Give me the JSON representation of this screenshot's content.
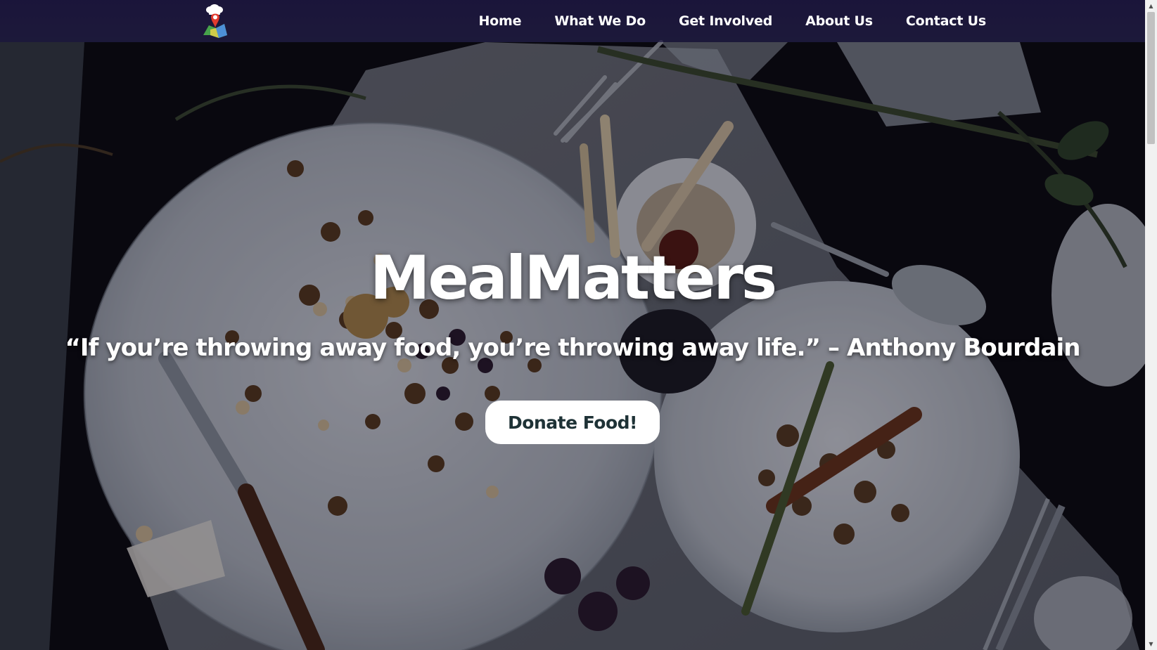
{
  "navbar": {
    "logo_name": "chef-map-pin-logo",
    "links": [
      {
        "label": "Home"
      },
      {
        "label": "What We Do"
      },
      {
        "label": "Get Involved"
      },
      {
        "label": "About Us"
      },
      {
        "label": "Contact Us"
      }
    ]
  },
  "hero": {
    "title": "MealMatters",
    "quote": "“If you’re throwing away food, you’re throwing away life.” – Anthony Bourdain",
    "cta_label": "Donate Food!",
    "background_description_icon": "leftover-food-plates-photo"
  },
  "colors": {
    "navbar_bg": "#1c163e",
    "text": "#ffffff",
    "button_bg": "#ffffff",
    "button_text": "#1e3236"
  }
}
